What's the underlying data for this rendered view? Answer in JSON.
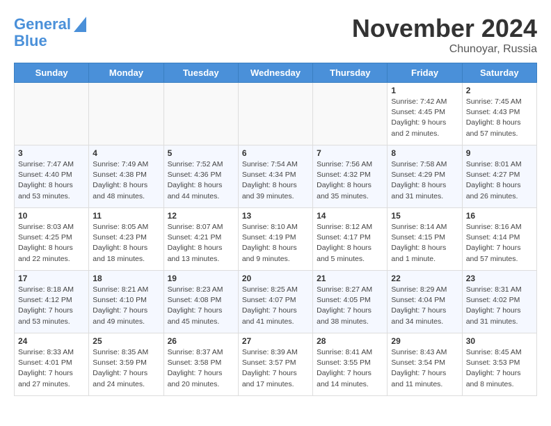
{
  "header": {
    "logo_line1": "General",
    "logo_line2": "Blue",
    "month": "November 2024",
    "location": "Chunoyar, Russia"
  },
  "weekdays": [
    "Sunday",
    "Monday",
    "Tuesday",
    "Wednesday",
    "Thursday",
    "Friday",
    "Saturday"
  ],
  "weeks": [
    [
      {
        "day": "",
        "info": ""
      },
      {
        "day": "",
        "info": ""
      },
      {
        "day": "",
        "info": ""
      },
      {
        "day": "",
        "info": ""
      },
      {
        "day": "",
        "info": ""
      },
      {
        "day": "1",
        "info": "Sunrise: 7:42 AM\nSunset: 4:45 PM\nDaylight: 9 hours\nand 2 minutes."
      },
      {
        "day": "2",
        "info": "Sunrise: 7:45 AM\nSunset: 4:43 PM\nDaylight: 8 hours\nand 57 minutes."
      }
    ],
    [
      {
        "day": "3",
        "info": "Sunrise: 7:47 AM\nSunset: 4:40 PM\nDaylight: 8 hours\nand 53 minutes."
      },
      {
        "day": "4",
        "info": "Sunrise: 7:49 AM\nSunset: 4:38 PM\nDaylight: 8 hours\nand 48 minutes."
      },
      {
        "day": "5",
        "info": "Sunrise: 7:52 AM\nSunset: 4:36 PM\nDaylight: 8 hours\nand 44 minutes."
      },
      {
        "day": "6",
        "info": "Sunrise: 7:54 AM\nSunset: 4:34 PM\nDaylight: 8 hours\nand 39 minutes."
      },
      {
        "day": "7",
        "info": "Sunrise: 7:56 AM\nSunset: 4:32 PM\nDaylight: 8 hours\nand 35 minutes."
      },
      {
        "day": "8",
        "info": "Sunrise: 7:58 AM\nSunset: 4:29 PM\nDaylight: 8 hours\nand 31 minutes."
      },
      {
        "day": "9",
        "info": "Sunrise: 8:01 AM\nSunset: 4:27 PM\nDaylight: 8 hours\nand 26 minutes."
      }
    ],
    [
      {
        "day": "10",
        "info": "Sunrise: 8:03 AM\nSunset: 4:25 PM\nDaylight: 8 hours\nand 22 minutes."
      },
      {
        "day": "11",
        "info": "Sunrise: 8:05 AM\nSunset: 4:23 PM\nDaylight: 8 hours\nand 18 minutes."
      },
      {
        "day": "12",
        "info": "Sunrise: 8:07 AM\nSunset: 4:21 PM\nDaylight: 8 hours\nand 13 minutes."
      },
      {
        "day": "13",
        "info": "Sunrise: 8:10 AM\nSunset: 4:19 PM\nDaylight: 8 hours\nand 9 minutes."
      },
      {
        "day": "14",
        "info": "Sunrise: 8:12 AM\nSunset: 4:17 PM\nDaylight: 8 hours\nand 5 minutes."
      },
      {
        "day": "15",
        "info": "Sunrise: 8:14 AM\nSunset: 4:15 PM\nDaylight: 8 hours\nand 1 minute."
      },
      {
        "day": "16",
        "info": "Sunrise: 8:16 AM\nSunset: 4:14 PM\nDaylight: 7 hours\nand 57 minutes."
      }
    ],
    [
      {
        "day": "17",
        "info": "Sunrise: 8:18 AM\nSunset: 4:12 PM\nDaylight: 7 hours\nand 53 minutes."
      },
      {
        "day": "18",
        "info": "Sunrise: 8:21 AM\nSunset: 4:10 PM\nDaylight: 7 hours\nand 49 minutes."
      },
      {
        "day": "19",
        "info": "Sunrise: 8:23 AM\nSunset: 4:08 PM\nDaylight: 7 hours\nand 45 minutes."
      },
      {
        "day": "20",
        "info": "Sunrise: 8:25 AM\nSunset: 4:07 PM\nDaylight: 7 hours\nand 41 minutes."
      },
      {
        "day": "21",
        "info": "Sunrise: 8:27 AM\nSunset: 4:05 PM\nDaylight: 7 hours\nand 38 minutes."
      },
      {
        "day": "22",
        "info": "Sunrise: 8:29 AM\nSunset: 4:04 PM\nDaylight: 7 hours\nand 34 minutes."
      },
      {
        "day": "23",
        "info": "Sunrise: 8:31 AM\nSunset: 4:02 PM\nDaylight: 7 hours\nand 31 minutes."
      }
    ],
    [
      {
        "day": "24",
        "info": "Sunrise: 8:33 AM\nSunset: 4:01 PM\nDaylight: 7 hours\nand 27 minutes."
      },
      {
        "day": "25",
        "info": "Sunrise: 8:35 AM\nSunset: 3:59 PM\nDaylight: 7 hours\nand 24 minutes."
      },
      {
        "day": "26",
        "info": "Sunrise: 8:37 AM\nSunset: 3:58 PM\nDaylight: 7 hours\nand 20 minutes."
      },
      {
        "day": "27",
        "info": "Sunrise: 8:39 AM\nSunset: 3:57 PM\nDaylight: 7 hours\nand 17 minutes."
      },
      {
        "day": "28",
        "info": "Sunrise: 8:41 AM\nSunset: 3:55 PM\nDaylight: 7 hours\nand 14 minutes."
      },
      {
        "day": "29",
        "info": "Sunrise: 8:43 AM\nSunset: 3:54 PM\nDaylight: 7 hours\nand 11 minutes."
      },
      {
        "day": "30",
        "info": "Sunrise: 8:45 AM\nSunset: 3:53 PM\nDaylight: 7 hours\nand 8 minutes."
      }
    ]
  ]
}
